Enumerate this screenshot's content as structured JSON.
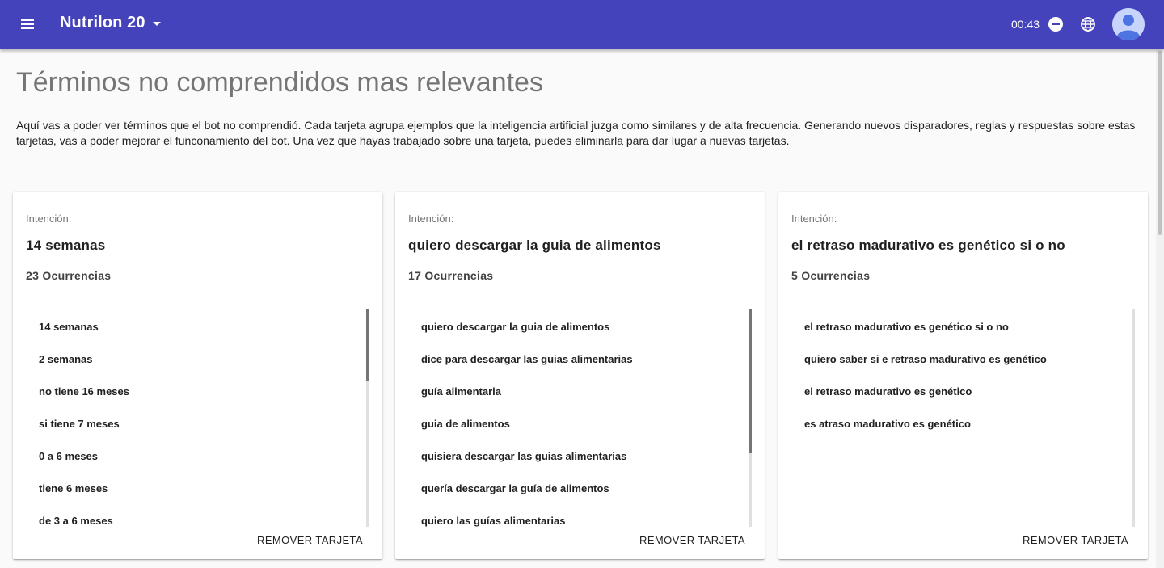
{
  "header": {
    "app_name": "Nutrilon 20",
    "clock": "00:43",
    "colors": {
      "appbar": "#4543bb"
    },
    "icons": [
      "menu-icon",
      "chevron-down-icon",
      "do-not-disturb-icon",
      "globe-icon",
      "avatar"
    ]
  },
  "page": {
    "title": "Términos no comprendidos mas relevantes",
    "intro": "Aquí vas a poder ver términos que el bot no comprendió. Cada tarjeta agrupa ejemplos que la inteligencia artificial juzga como similares y de alta frecuencia. Generando nuevos disparadores, reglas y respuestas sobre estas tarjetas, vas a poder mejorar el funconamiento del bot. Una vez que hayas trabajado sobre una tarjeta, puedes eliminarla para dar lugar a nuevas tarjetas."
  },
  "cards": [
    {
      "label": "Intención:",
      "intent": "14 semanas",
      "count": "23 Ocurrencias",
      "examples": [
        "14 semanas",
        "2 semanas",
        "no tiene 16 meses",
        "si tiene 7 meses",
        "0 a 6 meses",
        "tiene 6 meses",
        "de 3 a 6 meses"
      ],
      "remove_label": "REMOVER TARJETA"
    },
    {
      "label": "Intención:",
      "intent": "quiero descargar la guia de alimentos",
      "count": "17 Ocurrencias",
      "examples": [
        "quiero descargar la guia de alimentos",
        "dice para descargar las guias alimentarias",
        "guía alimentaria",
        "guia de alimentos",
        "quisiera descargar las guias alimentarias",
        "quería descargar la guía de alimentos",
        "quiero las guías alimentarias"
      ],
      "remove_label": "REMOVER TARJETA"
    },
    {
      "label": "Intención:",
      "intent": "el retraso madurativo es genético si o no",
      "count": "5 Ocurrencias",
      "examples": [
        "el retraso madurativo es genético si o no",
        "quiero saber si e retraso madurativo es genético",
        "el retraso madurativo es genético",
        "es atraso madurativo es genético"
      ],
      "remove_label": "REMOVER TARJETA"
    }
  ]
}
